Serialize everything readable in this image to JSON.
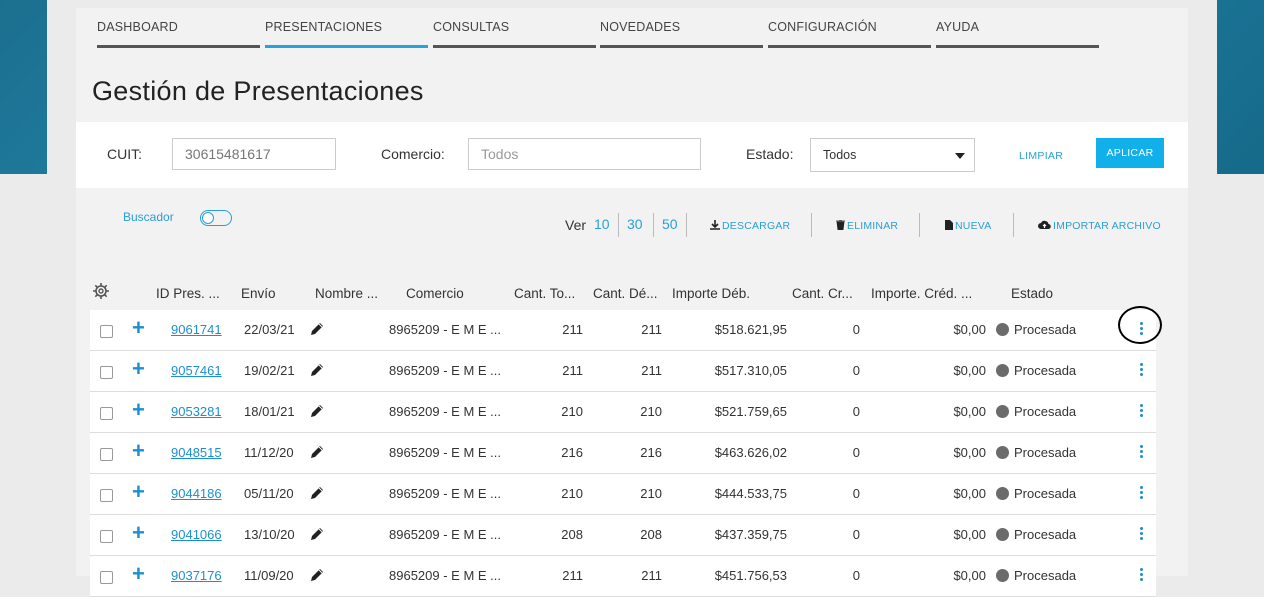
{
  "nav": [
    {
      "label": "DASHBOARD",
      "active": false
    },
    {
      "label": "PRESENTACIONES",
      "active": true
    },
    {
      "label": "CONSULTAS",
      "active": false
    },
    {
      "label": "NOVEDADES",
      "active": false
    },
    {
      "label": "CONFIGURACIÓN",
      "active": false
    },
    {
      "label": "AYUDA",
      "active": false
    }
  ],
  "page_title": "Gestión de Presentaciones",
  "filters": {
    "cuit_label": "CUIT:",
    "cuit_value": "30615481617",
    "comercio_label": "Comercio:",
    "comercio_placeholder": "Todos",
    "estado_label": "Estado:",
    "estado_value": "Todos",
    "limpiar": "LIMPIAR",
    "aplicar": "APLICAR"
  },
  "toolbar": {
    "buscador": "Buscador",
    "ver": "Ver",
    "page_sizes": [
      "10",
      "30",
      "50"
    ],
    "descargar": "DESCARGAR",
    "eliminar": "ELIMINAR",
    "nueva": "NUEVA",
    "importar": "IMPORTAR ARCHIVO"
  },
  "table": {
    "headers": [
      "ID Pres. ...",
      "Envío",
      "Nombre ...",
      "Comercio",
      "Cant. To...",
      "Cant. Dé...",
      "Importe Déb.",
      "Cant. Cr...",
      "Importe. Créd. ...",
      "Estado"
    ],
    "rows": [
      {
        "id": "9061741",
        "envio": "22/03/21",
        "comercio": "8965209 - E M E ...",
        "cant_total": "211",
        "cant_deb": "211",
        "importe_deb": "$518.621,95",
        "cant_cred": "0",
        "importe_cred": "$0,00",
        "estado": "Procesada"
      },
      {
        "id": "9057461",
        "envio": "19/02/21",
        "comercio": "8965209 - E M E ...",
        "cant_total": "211",
        "cant_deb": "211",
        "importe_deb": "$517.310,05",
        "cant_cred": "0",
        "importe_cred": "$0,00",
        "estado": "Procesada"
      },
      {
        "id": "9053281",
        "envio": "18/01/21",
        "comercio": "8965209 - E M E ...",
        "cant_total": "210",
        "cant_deb": "210",
        "importe_deb": "$521.759,65",
        "cant_cred": "0",
        "importe_cred": "$0,00",
        "estado": "Procesada"
      },
      {
        "id": "9048515",
        "envio": "11/12/20",
        "comercio": "8965209 - E M E ...",
        "cant_total": "216",
        "cant_deb": "216",
        "importe_deb": "$463.626,02",
        "cant_cred": "0",
        "importe_cred": "$0,00",
        "estado": "Procesada"
      },
      {
        "id": "9044186",
        "envio": "05/11/20",
        "comercio": "8965209 - E M E ...",
        "cant_total": "210",
        "cant_deb": "210",
        "importe_deb": "$444.533,75",
        "cant_cred": "0",
        "importe_cred": "$0,00",
        "estado": "Procesada"
      },
      {
        "id": "9041066",
        "envio": "13/10/20",
        "comercio": "8965209 - E M E ...",
        "cant_total": "208",
        "cant_deb": "208",
        "importe_deb": "$437.359,75",
        "cant_cred": "0",
        "importe_cred": "$0,00",
        "estado": "Procesada"
      },
      {
        "id": "9037176",
        "envio": "11/09/20",
        "comercio": "8965209 - E M E ...",
        "cant_total": "211",
        "cant_deb": "211",
        "importe_deb": "$451.756,53",
        "cant_cred": "0",
        "importe_cred": "$0,00",
        "estado": "Procesada"
      }
    ]
  },
  "colors": {
    "accent": "#21a6dc",
    "primary_button": "#12b0ea",
    "status_dot": "#6b6b6b",
    "header_band": "#1d7a9c"
  }
}
